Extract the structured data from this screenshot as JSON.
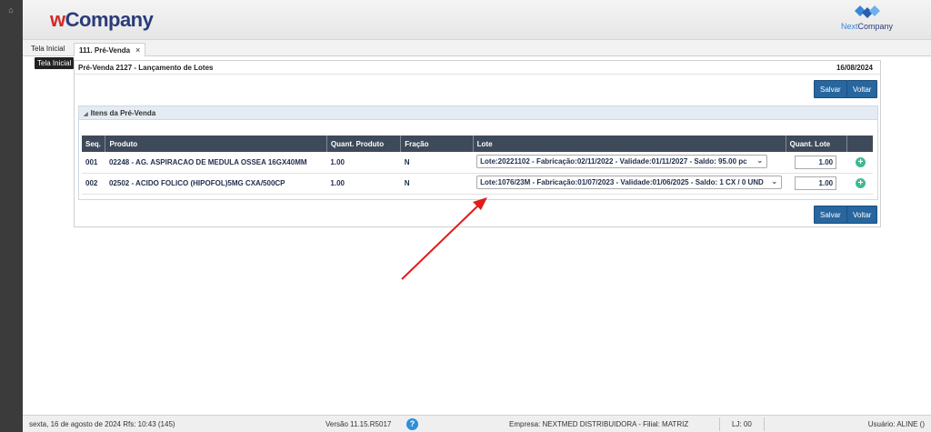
{
  "header": {
    "brand_w": "w",
    "brand_rest": "Company",
    "logo_text_n": "Next",
    "logo_text_rest": "Company"
  },
  "tabs": [
    {
      "label": "Tela Inicial"
    },
    {
      "label": "111. Pré-Venda",
      "close": "×"
    }
  ],
  "tooltip": "Tela Inicial",
  "panel": {
    "title": "Pré-Venda 2127 - Lançamento de Lotes",
    "date": "16/08/2024",
    "save_label": "Salvar",
    "back_label": "Voltar",
    "section_title": "Itens da Pré-Venda"
  },
  "table": {
    "headers": [
      "Seq.",
      "Produto",
      "Quant. Produto",
      "Fração",
      "Lote",
      "Quant. Lote",
      ""
    ],
    "rows": [
      {
        "seq": "001",
        "produto": "02248 - AG. ASPIRACAO DE MEDULA OSSEA 16GX40MM",
        "quant": "1.00",
        "fracao": "N",
        "lote": "Lote:20221102 - Fabricação:02/11/2022 - Validade:01/11/2027 - Saldo: 95.00 pc",
        "quant_lote": "1.00"
      },
      {
        "seq": "002",
        "produto": "02502 - ACIDO FOLICO (HIPOFOL)5MG CXA/500CP",
        "quant": "1.00",
        "fracao": "N",
        "lote": "Lote:1076/23M - Fabricação:01/07/2023 - Validade:01/06/2025 - Saldo: 1 CX / 0 UND",
        "quant_lote": "1.00"
      }
    ]
  },
  "footer": {
    "date": "sexta, 16 de agosto de 2024  Rfs: 10:43 (145)",
    "version": "Versão 11.15.R5017",
    "help": "?",
    "company": "Empresa: NEXTMED DISTRIBUIDORA - Filial: MATRIZ",
    "lj": "LJ: 00",
    "user": "Usuário: ALINE ()"
  },
  "colors": {
    "brand_blue": "#2a3b7a",
    "brand_red": "#d12a2a",
    "button": "#27669e",
    "table_header": "#3e4a59",
    "add_green": "#3fba8f",
    "arrow": "#e21b1b"
  }
}
